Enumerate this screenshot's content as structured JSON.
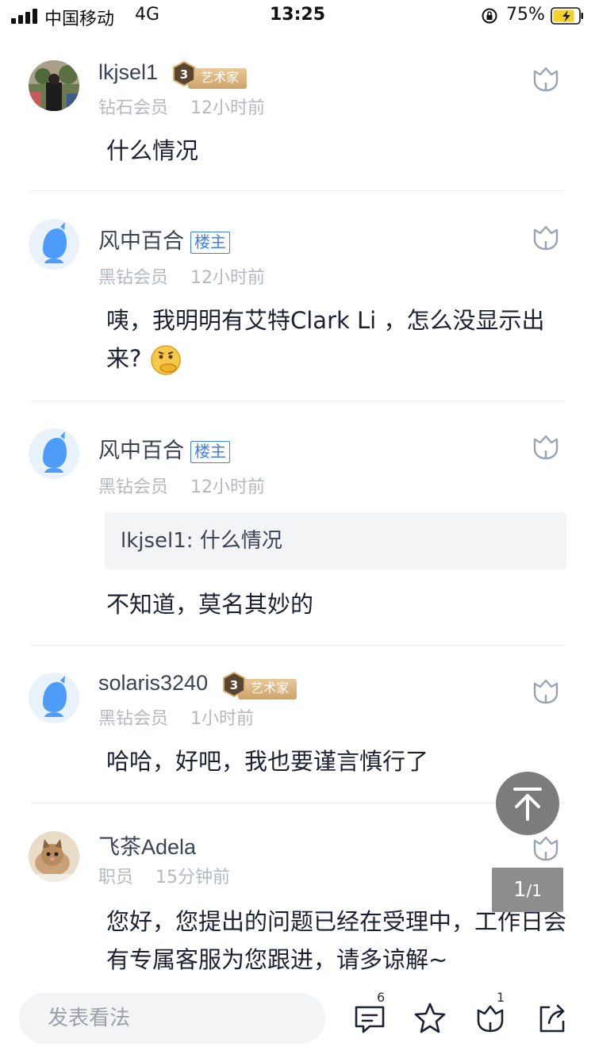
{
  "status_bar": {
    "carrier": "中国移动",
    "network": "4G",
    "time": "13:25",
    "battery": "75%"
  },
  "comments": [
    {
      "username": "lkjsel1",
      "badge": "艺术家",
      "badge_level": "3",
      "level": "钻石会员",
      "time": "12小时前",
      "text": "什么情况"
    },
    {
      "username": "风中百合",
      "badge": "楼主",
      "level": "黑钻会员",
      "time": "12小时前",
      "text": "咦，我明明有艾特Clark Li ，怎么没显示出来?"
    },
    {
      "username": "风中百合",
      "badge": "楼主",
      "level": "黑钻会员",
      "time": "12小时前",
      "quote": "lkjsel1: 什么情况",
      "text": "不知道，莫名其妙的"
    },
    {
      "username": "solaris3240",
      "badge": "艺术家",
      "badge_level": "3",
      "level": "黑钻会员",
      "time": "1小时前",
      "text": "哈哈，好吧，我也要谨言慎行了"
    },
    {
      "username": "飞茶Adela",
      "level": "职员",
      "time": "15分钟前",
      "text": "您好，您提出的问题已经在受理中，工作日会有专属客服为您跟进，请多谅解~"
    }
  ],
  "page_indicator": {
    "current": "1",
    "total": "/1"
  },
  "bottom_bar": {
    "placeholder": "发表看法",
    "comment_count": "6",
    "like_count": "1"
  }
}
